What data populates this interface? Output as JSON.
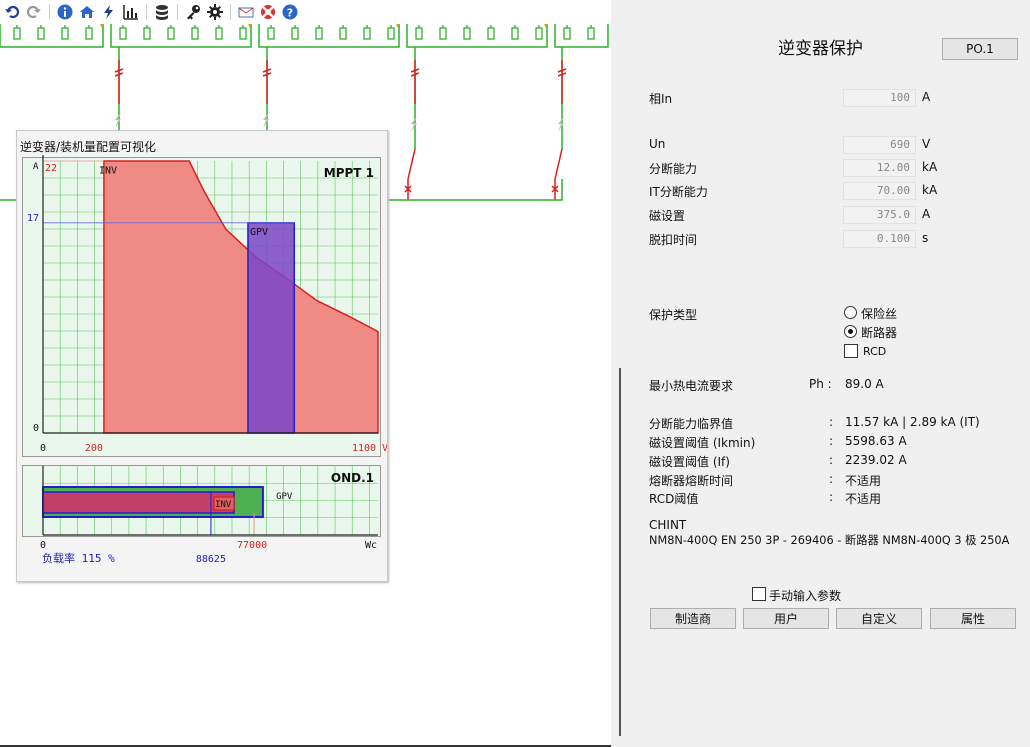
{
  "toolbar": {
    "icons": [
      "undo-icon",
      "redo-icon",
      "info-icon",
      "home-icon",
      "lightning-icon",
      "bar-chart-icon",
      "database-icon",
      "key-icon",
      "gear-icon",
      "mail-icon",
      "lifebuoy-icon",
      "help-icon"
    ]
  },
  "colors": {
    "accent_red": "#d92020",
    "accent_green": "#2bb02b",
    "bar_red": "#f08a84",
    "bar_blue": "#7a45c8",
    "chart_bg": "#e9f7ec",
    "panel_bg": "#f0f0f0"
  },
  "popup": {
    "title": "逆变器/装机量配置可视化",
    "chart1": {
      "label": "MPPT 1",
      "y_unit": "A",
      "y_ticks": [
        "22",
        "17",
        "0"
      ],
      "x_ticks": [
        "0",
        "200",
        "1100 V"
      ],
      "x_ticks_blue": [
        "673",
        "825"
      ],
      "inv_label": "INV",
      "gpv_label": "GPV"
    },
    "chart2": {
      "label": "OND.1",
      "x_ticks": [
        "0",
        "77000",
        "Wc"
      ],
      "load_label": "负载率 115 %",
      "x_tick_blue": "88625",
      "inv_label": "INV",
      "gpv_label": "GPV"
    }
  },
  "chart_data": [
    {
      "type": "area",
      "title": "MPPT 1",
      "ylabel": "A",
      "xlim": [
        0,
        1100
      ],
      "ylim": [
        0,
        22
      ],
      "series": [
        {
          "name": "INV",
          "x": [
            200,
            200,
            480,
            530,
            600,
            700,
            800,
            900,
            1000,
            1100,
            1100
          ],
          "y": [
            0,
            22,
            22,
            19.5,
            16.5,
            14.2,
            12.5,
            10.7,
            9.5,
            8.2,
            0
          ]
        },
        {
          "name": "GPV",
          "x": [
            673,
            825
          ],
          "y": [
            0,
            17
          ]
        }
      ],
      "reference_lines": {
        "y": 17,
        "x": [
          673,
          825
        ]
      }
    },
    {
      "type": "bar",
      "title": "OND.1",
      "xlabel": "Wc",
      "series": [
        {
          "name": "INV",
          "value": 77000
        },
        {
          "name": "GPV",
          "value": 88625
        }
      ],
      "load_ratio": "115 %"
    }
  ],
  "protection": {
    "title": "逆变器保护",
    "po_button": "PO.1",
    "fields": [
      {
        "label": "相In",
        "value": "100",
        "unit": "A"
      },
      {
        "label": "Un",
        "value": "690",
        "unit": "V"
      },
      {
        "label": "分断能力",
        "value": "12.00",
        "unit": "kA"
      },
      {
        "label": "IT分断能力",
        "value": "70.00",
        "unit": "kA"
      },
      {
        "label": "磁设置",
        "value": "375.0",
        "unit": "A"
      },
      {
        "label": "脱扣时间",
        "value": "0.100",
        "unit": "s"
      }
    ],
    "type_label": "保护类型",
    "options": {
      "fuse": "保险丝",
      "breaker": "断路器",
      "rcd": "RCD"
    },
    "min_current": {
      "label": "最小热电流要求",
      "ph": "Ph :",
      "value": "89.0 A"
    },
    "results": [
      {
        "label": "分断能力临界值",
        "sep": ":",
        "value": "11.57 kA  |  2.89 kA (IT)"
      },
      {
        "label": "磁设置阈值 (Ikmin)",
        "sep": ":",
        "value": "5598.63 A"
      },
      {
        "label": "磁设置阈值 (If)",
        "sep": ":",
        "value": "2239.02 A"
      },
      {
        "label": "熔断器熔断时间",
        "sep": ":",
        "value": "不适用"
      },
      {
        "label": "RCD阈值",
        "sep": ":",
        "value": "不适用"
      }
    ],
    "maker": "CHINT",
    "device": "NM8N-400Q EN 250 3P - 269406 - 断路器 NM8N-400Q 3 极 250A",
    "manual_input": "手动输入参数",
    "buttons": [
      "制造商",
      "用户",
      "自定义",
      "属性"
    ]
  }
}
